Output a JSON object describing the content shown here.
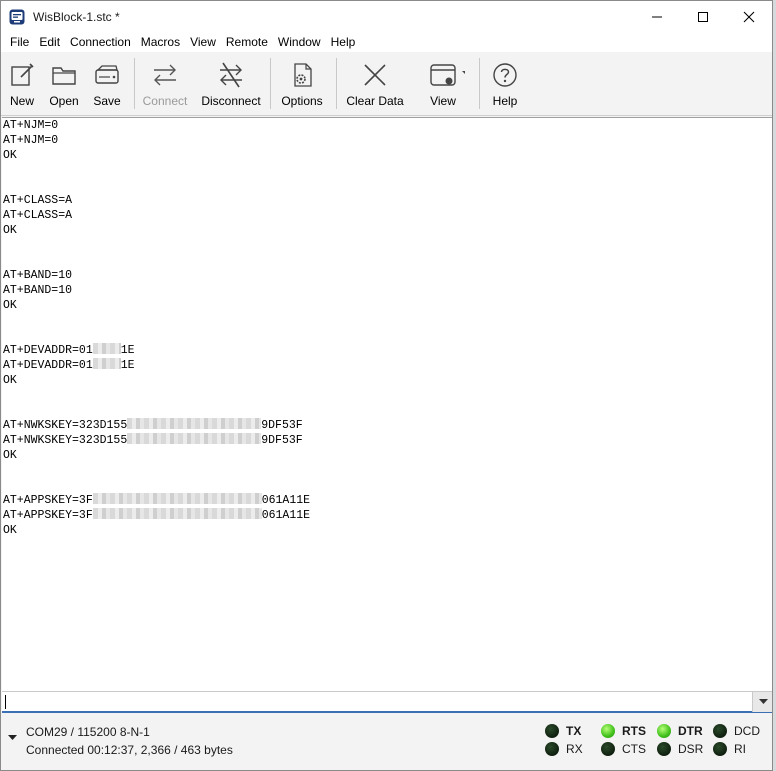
{
  "window": {
    "title": "WisBlock-1.stc *"
  },
  "menu": [
    "File",
    "Edit",
    "Connection",
    "Macros",
    "View",
    "Remote",
    "Window",
    "Help"
  ],
  "toolbar": {
    "new": "New",
    "open": "Open",
    "save": "Save",
    "connect": "Connect",
    "disconnect": "Disconnect",
    "options": "Options",
    "clear_data": "Clear Data",
    "view": "View",
    "help": "Help"
  },
  "terminal": {
    "lines": [
      "AT+NJM=0",
      "AT+NJM=0",
      "OK",
      "",
      "",
      "AT+CLASS=A",
      "AT+CLASS=A",
      "OK",
      "",
      "",
      "AT+BAND=10",
      "AT+BAND=10",
      "OK",
      "",
      "",
      "AT+DEVADDR=01",
      "AT+DEVADDR=01",
      "OK",
      "",
      "",
      "AT+NWKSKEY=323D155",
      "AT+NWKSKEY=323D155",
      "OK",
      "",
      "",
      "AT+APPSKEY=3F",
      "AT+APPSKEY=3F",
      "OK"
    ],
    "redacted_suffixes": {
      "devaddr": "1E",
      "nwkskey": "9DF53F",
      "appskey": "061A11E"
    }
  },
  "input": {
    "value": ""
  },
  "status": {
    "port": "COM29 / 115200 8-N-1",
    "connection": "Connected 00:12:37, 2,366 / 463 bytes",
    "signals": {
      "tx": "TX",
      "rx": "RX",
      "rts": "RTS",
      "cts": "CTS",
      "dtr": "DTR",
      "dsr": "DSR",
      "dcd": "DCD",
      "ri": "RI"
    },
    "colors": {
      "led_on": "#3fbf1a",
      "led_off": "#0f1f0f"
    }
  }
}
